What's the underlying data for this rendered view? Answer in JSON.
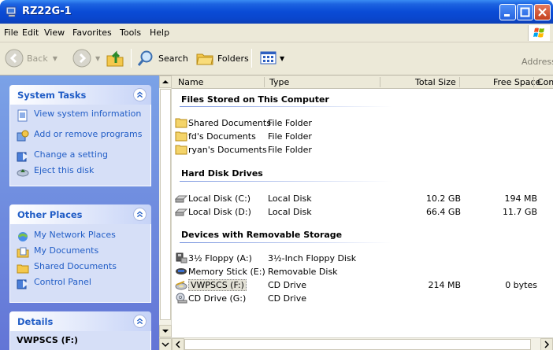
{
  "window": {
    "title": "RZ22G-1"
  },
  "menu": [
    "File",
    "Edit",
    "View",
    "Favorites",
    "Tools",
    "Help"
  ],
  "toolbar": {
    "back": "Back",
    "search": "Search",
    "folders": "Folders",
    "address": "Address"
  },
  "left_panel": {
    "system_tasks": {
      "title": "System Tasks",
      "items": [
        "View system information",
        "Add or remove programs",
        "Change a setting",
        "Eject this disk"
      ]
    },
    "other_places": {
      "title": "Other Places",
      "items": [
        "My Network Places",
        "My Documents",
        "Shared Documents",
        "Control Panel"
      ]
    },
    "details": {
      "title": "Details",
      "name": "VWPSCS (F:)"
    }
  },
  "columns": [
    "Name",
    "Type",
    "Total Size",
    "Free Space",
    "Com"
  ],
  "groups": [
    {
      "title": "Files Stored on This Computer",
      "rows": [
        {
          "name": "Shared Documents",
          "type": "File Folder",
          "total": "",
          "free": "",
          "icon": "folder-icon"
        },
        {
          "name": "fd's Documents",
          "type": "File Folder",
          "total": "",
          "free": "",
          "icon": "folder-icon"
        },
        {
          "name": "ryan's Documents",
          "type": "File Folder",
          "total": "",
          "free": "",
          "icon": "folder-icon"
        }
      ]
    },
    {
      "title": "Hard Disk Drives",
      "rows": [
        {
          "name": "Local Disk (C:)",
          "type": "Local Disk",
          "total": "10.2 GB",
          "free": "194 MB",
          "icon": "hard-disk-icon"
        },
        {
          "name": "Local Disk (D:)",
          "type": "Local Disk",
          "total": "66.4 GB",
          "free": "11.7 GB",
          "icon": "hard-disk-icon"
        }
      ]
    },
    {
      "title": "Devices with Removable Storage",
      "rows": [
        {
          "name": "3½ Floppy (A:)",
          "type": "3½-Inch Floppy Disk",
          "total": "",
          "free": "",
          "icon": "floppy-drive-icon"
        },
        {
          "name": "Memory Stick (E:)",
          "type": "Removable Disk",
          "total": "",
          "free": "",
          "icon": "memory-stick-icon"
        },
        {
          "name": "VWPSCS (F:)",
          "type": "CD Drive",
          "total": "214 MB",
          "free": "0 bytes",
          "icon": "cd-disc-icon"
        },
        {
          "name": "CD Drive (G:)",
          "type": "CD Drive",
          "total": "",
          "free": "",
          "icon": "cd-drive-icon"
        }
      ]
    }
  ],
  "colors": {
    "title_bar": "#0a4bd6",
    "task_pane": "#6f8fe0",
    "task_link": "#215dc6",
    "selection": "#e3e1d6"
  }
}
